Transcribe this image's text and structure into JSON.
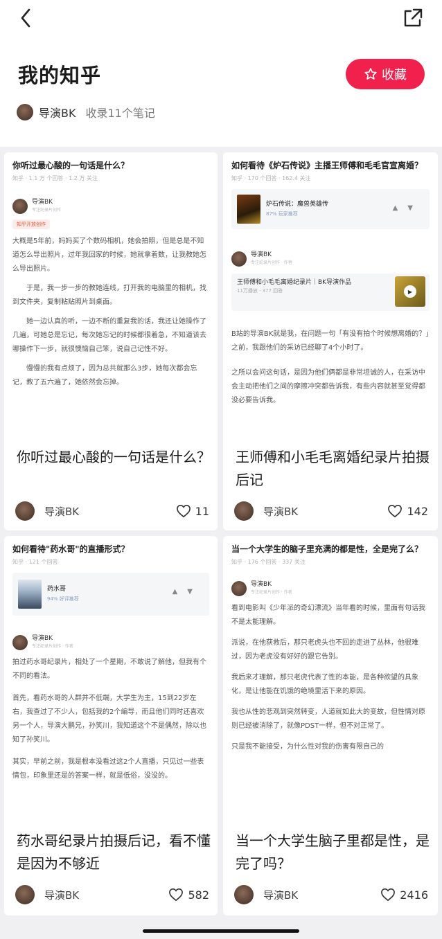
{
  "header": {
    "title": "我的知乎",
    "collect_label": "收藏",
    "author": "导演BK",
    "note_count": "收录11个笔记"
  },
  "cards": [
    {
      "preview": {
        "question": "你听过最心酸的一句话是什么？",
        "meta": "知乎 · 1.1 万 个回答 · 1.2 万 关注",
        "author": "导演BK",
        "author_sub": "专注纪录片创作",
        "tag": "知乎开放创作",
        "paragraphs": [
          "大概是5年前，妈妈买了个数码相机，她会拍照，但是总是不知道怎么导出照片，过年我回家的时候，她就拿着数，让我教她怎么导出照片。",
          "于是，我一步一步的教她连线，打开我的电脑里的相机，找到文件夹，复制粘贴照片到桌面。",
          "她一边认真的听，一边不断的重复我的话，我还让她操作了几遍，可她总是忘记，每次她忘记的时候都很着急，不知道该去哪操作下一步，就很懊恼自己笨，说自己记性不好。",
          "慢慢的我有点烦了，因为总共就那么3步，她每次都会忘记，教了五六遍了，她依然会忘掉。"
        ]
      },
      "title": "你听过最心酸的一句话是什么？",
      "author": "导演BK",
      "likes": "11"
    },
    {
      "preview": {
        "question": "如何看待《炉石传说》主播王师傅和毛毛官宣离婚？",
        "meta": "知乎 · 170 个回答 · 162.4 关注",
        "embed_title": "炉石传说：魔兽英雄传",
        "embed_score": "87% 玩家推荐",
        "author": "导演BK",
        "author_sub": "专注纪录片创作 · 作者",
        "link_title": "王师傅和小毛毛离婚纪录片｜BK导演作品",
        "link_meta": "11万播放 · 377 回答",
        "paragraphs": [
          "B站的导演BK就是我，在问题一句「有没有拍个时候想离婚的？」之前，我跟他们的采访已经聊了4个小时了。",
          "之所以会问这句话，是因为他们俩都是非常坦诚的人，在采访中会主动把他们之间的摩擦冲突都告诉我，有些内容就甚至觉得都没必要告诉我。"
        ]
      },
      "title": "王师傅和小毛毛离婚纪录片拍摄后记",
      "author": "导演BK",
      "likes": "142"
    },
    {
      "preview": {
        "question": "如何看待\"药水哥\"的直播形式？",
        "meta": "知乎 · 121 个回答",
        "embed_title": "药水哥",
        "embed_score": "94% 好评推荐",
        "author": "导演BK",
        "author_sub": "专注纪录片创作 · 作者",
        "paragraphs": [
          "拍过药水哥纪录片，相处了一个星期，不敢说了解他，但我有个不同的看法。",
          "首先，看药水哥的人群并不低端，大学生为主，15到22岁左右，我查过了不少人，包括我的2个编导，而且他们同时还喜欢另一个人，导演大鹏兄，孙笑川，我知道这个不是偶然，除以也知了孙笑川。",
          "其实，早前之前，我是根本没看过这2个人直播，只见过一些表情包，印象里还是的答案一样，就是低俗，没没的。"
        ]
      },
      "title": "药水哥纪录片拍摄后记，看不懂是因为不够近",
      "author": "导演BK",
      "likes": "582"
    },
    {
      "preview": {
        "question": "当一个大学生的脑子里充满的都是性，全是完了么？",
        "meta": "知乎 · 176 个回答 · 337 关注",
        "author": "导演BK",
        "author_sub": "专注纪录片创作 · 作者",
        "paragraphs": [
          "看到电影叫《少年派的奇幻漂流》当年看的时候，里面有句话我不是太能理解。",
          "派说，在他获救后，那只老虎头也不回的走进了丛林，他很难过，因为老虎没有好好的跟它告别。",
          "我后来才理解，那只老虎代表了性的本能，是各种欲望的具象化，是让他能在饥饿的绝境里活下来的原因。",
          "我也从性的悲观到突然转变，人道就如此大的变故，但性情对原则已经被消除了，就像PDST一样，但不对正常了。",
          "只是我不能接受，为什么性对我的伤害有限自己的"
        ]
      },
      "title": "当一个大学生脑子里都是性，是完了吗？",
      "author": "导演BK",
      "likes": "2416"
    }
  ]
}
